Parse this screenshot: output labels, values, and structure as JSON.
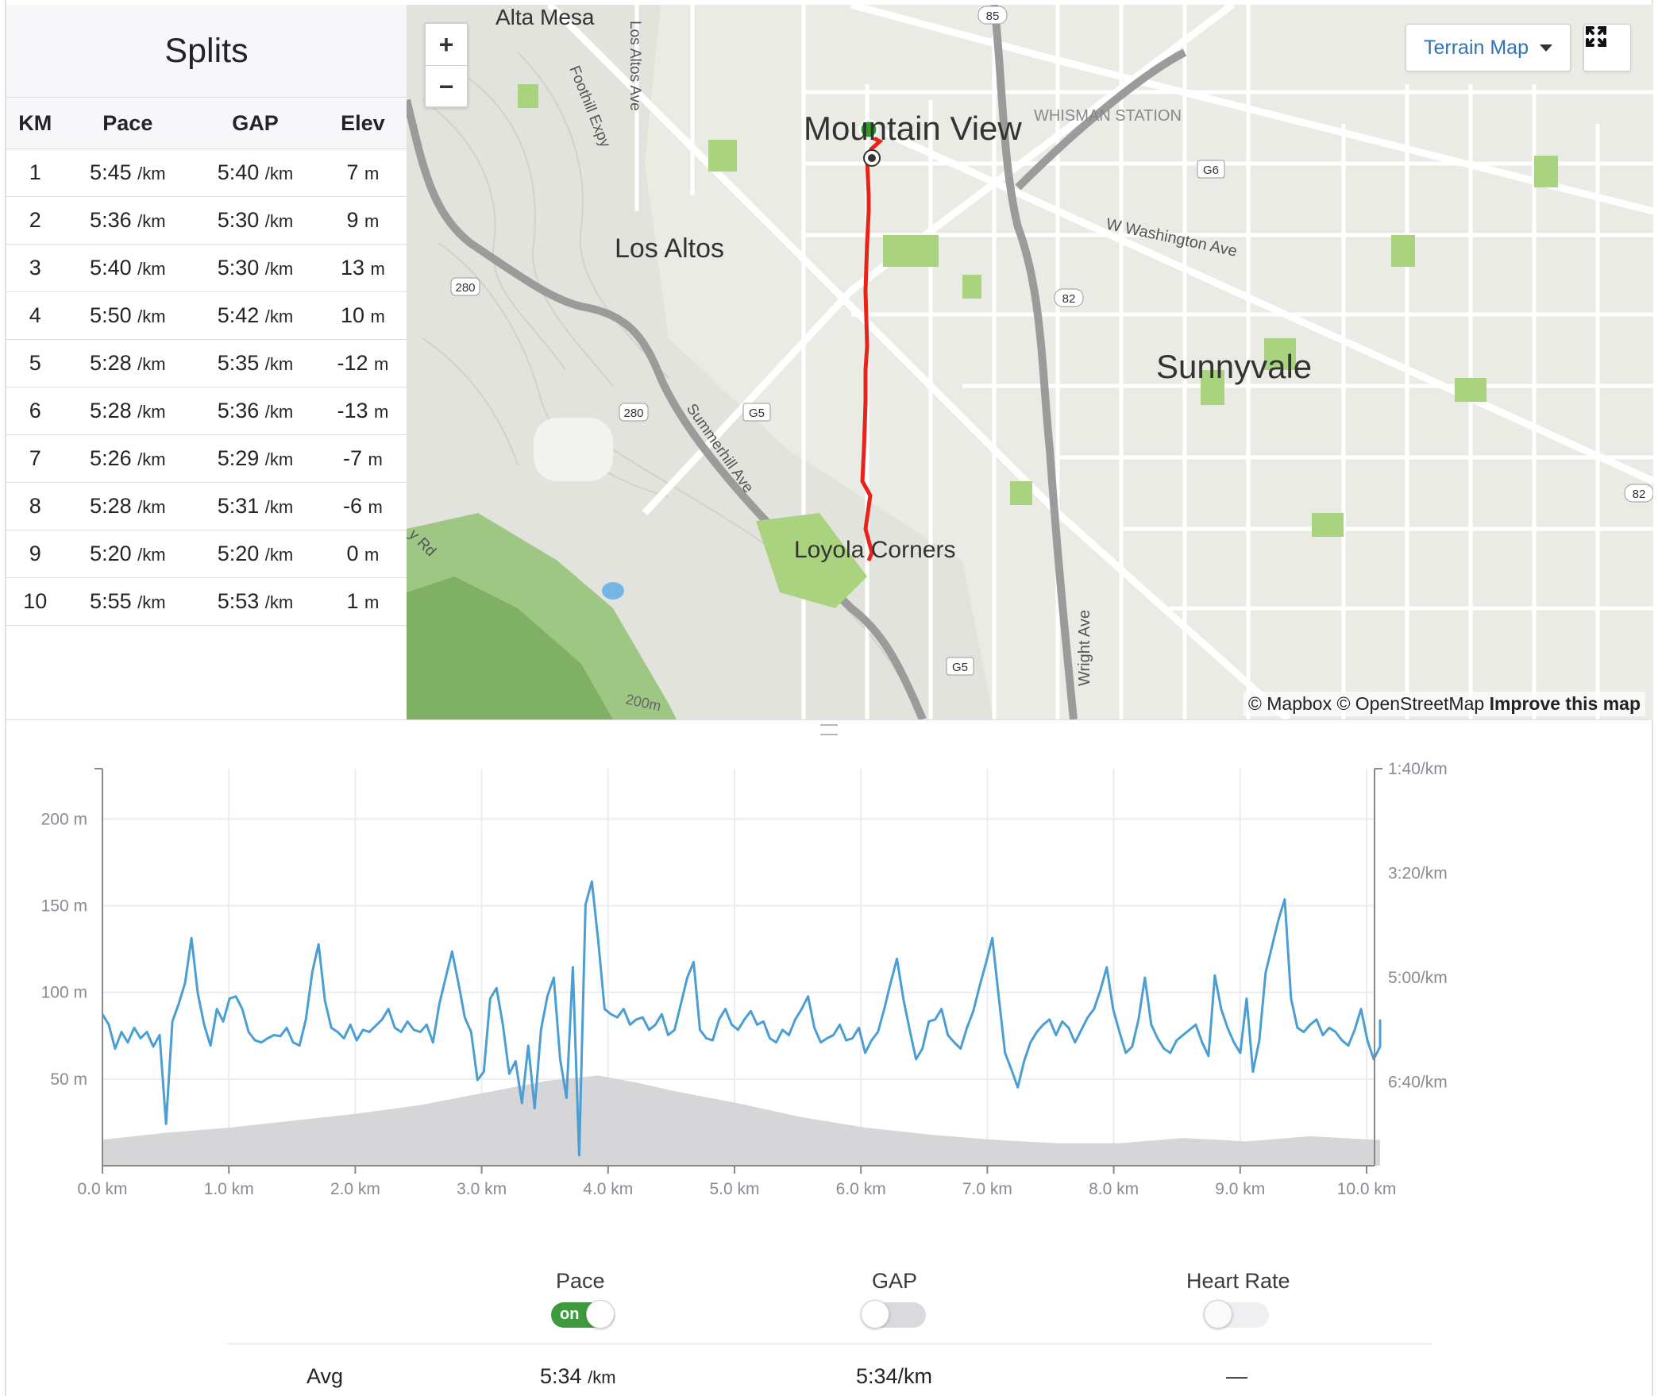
{
  "splits": {
    "title": "Splits",
    "columns": [
      "KM",
      "Pace",
      "GAP",
      "Elev"
    ],
    "rows": [
      {
        "km": "1",
        "pace": "5:45",
        "gap": "5:40",
        "elev": "7"
      },
      {
        "km": "2",
        "pace": "5:36",
        "gap": "5:30",
        "elev": "9"
      },
      {
        "km": "3",
        "pace": "5:40",
        "gap": "5:30",
        "elev": "13"
      },
      {
        "km": "4",
        "pace": "5:50",
        "gap": "5:42",
        "elev": "10"
      },
      {
        "km": "5",
        "pace": "5:28",
        "gap": "5:35",
        "elev": "-12"
      },
      {
        "km": "6",
        "pace": "5:28",
        "gap": "5:36",
        "elev": "-13"
      },
      {
        "km": "7",
        "pace": "5:26",
        "gap": "5:29",
        "elev": "-7"
      },
      {
        "km": "8",
        "pace": "5:28",
        "gap": "5:31",
        "elev": "-6"
      },
      {
        "km": "9",
        "pace": "5:20",
        "gap": "5:20",
        "elev": "0"
      },
      {
        "km": "10",
        "pace": "5:55",
        "gap": "5:53",
        "elev": "1"
      }
    ],
    "pace_unit": "/km",
    "elev_unit": "m"
  },
  "map": {
    "zoom_in": "+",
    "zoom_out": "−",
    "style_button": "Terrain Map",
    "fullscreen_icon": "expand-icon",
    "attribution_prefix": "© Mapbox © OpenStreetMap",
    "attribution_link": "Improve this map",
    "labels": {
      "alta_mesa": "Alta Mesa",
      "mountain_view": "Mountain View",
      "whisman_station": "WHISMAN STATION",
      "los_altos": "Los Altos",
      "sunnyvale": "Sunnyvale",
      "loyola_corners": "Loyola Corners",
      "foothill_expy": "Foothill Expy",
      "los_altos_ave": "Los Altos Ave",
      "summerhill_ave": "Summerhill Ave",
      "w_washington_ave": "W Washington Ave",
      "wright_ave": "Wright Ave",
      "rd_fragment": "y Rd",
      "contour_200": "200m"
    },
    "shields": {
      "s85": "85",
      "g6": "G6",
      "s82a": "82",
      "s280a": "280",
      "s280b": "280",
      "g5a": "G5",
      "g5b": "G5",
      "s82b": "82"
    },
    "colors": {
      "route": "#e8231a",
      "start": "#2aa02a",
      "park": "#a9d37e"
    }
  },
  "chart_data": {
    "type": "line",
    "xlabel": "",
    "ylabel": "",
    "x_ticks": [
      "0.0 km",
      "1.0 km",
      "2.0 km",
      "3.0 km",
      "4.0 km",
      "5.0 km",
      "6.0 km",
      "7.0 km",
      "8.0 km",
      "9.0 km",
      "10.0 km"
    ],
    "y_left_ticks": [
      "200 m",
      "150 m",
      "100 m",
      "50 m"
    ],
    "y_left_values": [
      200,
      150,
      100,
      50
    ],
    "y_right_ticks": [
      "1:40/km",
      "3:20/km",
      "5:00/km",
      "6:40/km"
    ],
    "xlim": [
      0,
      10.1
    ],
    "elevation_ylim": [
      0,
      240
    ],
    "pace_ylim_seconds": [
      100,
      480
    ],
    "series": [
      {
        "kind": "elevation-area",
        "color": "#d6d6d9",
        "x": [
          0,
          0.5,
          1.0,
          1.5,
          2.0,
          2.5,
          3.0,
          3.5,
          3.9,
          4.2,
          4.5,
          5.0,
          5.5,
          6.0,
          6.5,
          7.0,
          7.5,
          8.0,
          8.5,
          9.0,
          9.5,
          10.0,
          10.1
        ],
        "y": [
          15,
          19,
          22,
          26,
          30,
          35,
          42,
          49,
          52,
          48,
          43,
          36,
          28,
          22,
          18,
          15,
          13,
          13,
          16,
          14,
          17,
          15,
          15
        ]
      },
      {
        "kind": "pace-line",
        "color": "#4a9ed3",
        "x": [
          0,
          0.05,
          0.1,
          0.15,
          0.2,
          0.25,
          0.3,
          0.35,
          0.4,
          0.45,
          0.5,
          0.55,
          0.6,
          0.65,
          0.7,
          0.75,
          0.8,
          0.85,
          0.9,
          0.95,
          1.0,
          1.05,
          1.1,
          1.15,
          1.2,
          1.25,
          1.3,
          1.35,
          1.4,
          1.45,
          1.5,
          1.55,
          1.6,
          1.65,
          1.7,
          1.75,
          1.8,
          1.85,
          1.9,
          1.95,
          2.0,
          2.05,
          2.1,
          2.15,
          2.2,
          2.25,
          2.3,
          2.35,
          2.4,
          2.45,
          2.5,
          2.55,
          2.6,
          2.65,
          2.7,
          2.75,
          2.8,
          2.85,
          2.9,
          2.95,
          3.0,
          3.05,
          3.1,
          3.15,
          3.2,
          3.25,
          3.3,
          3.35,
          3.4,
          3.45,
          3.5,
          3.55,
          3.6,
          3.65,
          3.7,
          3.75,
          3.8,
          3.85,
          3.9,
          3.95,
          4.0,
          4.05,
          4.1,
          4.15,
          4.2,
          4.25,
          4.3,
          4.35,
          4.4,
          4.45,
          4.5,
          4.55,
          4.6,
          4.65,
          4.7,
          4.75,
          4.8,
          4.85,
          4.9,
          4.95,
          5.0,
          5.05,
          5.1,
          5.15,
          5.2,
          5.25,
          5.3,
          5.35,
          5.4,
          5.45,
          5.5,
          5.55,
          5.6,
          5.65,
          5.7,
          5.75,
          5.8,
          5.85,
          5.9,
          5.95,
          6.0,
          6.05,
          6.1,
          6.15,
          6.2,
          6.25,
          6.3,
          6.35,
          6.4,
          6.45,
          6.5,
          6.55,
          6.6,
          6.65,
          6.7,
          6.75,
          6.8,
          6.85,
          6.9,
          6.95,
          7.0,
          7.05,
          7.1,
          7.15,
          7.2,
          7.25,
          7.3,
          7.35,
          7.4,
          7.45,
          7.5,
          7.55,
          7.6,
          7.65,
          7.7,
          7.75,
          7.8,
          7.85,
          7.9,
          7.95,
          8.0,
          8.05,
          8.1,
          8.15,
          8.2,
          8.25,
          8.3,
          8.35,
          8.4,
          8.45,
          8.5,
          8.55,
          8.6,
          8.65,
          8.7,
          8.75,
          8.8,
          8.85,
          8.9,
          8.95,
          9.0,
          9.05,
          9.1,
          9.15,
          9.2,
          9.25,
          9.3,
          9.35,
          9.4,
          9.45,
          9.5,
          9.55,
          9.6,
          9.65,
          9.7,
          9.75,
          9.8,
          9.85,
          9.9,
          9.95,
          10.0,
          10.05,
          10.1
        ],
        "pace_seconds": [
          335,
          345,
          368,
          352,
          362,
          348,
          358,
          352,
          366,
          355,
          440,
          342,
          325,
          305,
          262,
          315,
          345,
          365,
          330,
          342,
          320,
          318,
          330,
          352,
          360,
          362,
          358,
          355,
          356,
          348,
          362,
          365,
          340,
          295,
          268,
          322,
          348,
          352,
          358,
          345,
          360,
          350,
          352,
          346,
          340,
          330,
          348,
          352,
          342,
          350,
          352,
          345,
          362,
          325,
          300,
          275,
          305,
          338,
          352,
          398,
          390,
          320,
          310,
          345,
          392,
          380,
          420,
          365,
          425,
          350,
          318,
          300,
          378,
          415,
          290,
          470,
          230,
          208,
          265,
          330,
          335,
          338,
          330,
          345,
          340,
          338,
          350,
          345,
          335,
          355,
          350,
          325,
          300,
          285,
          350,
          358,
          360,
          340,
          330,
          345,
          350,
          340,
          332,
          345,
          342,
          358,
          362,
          350,
          355,
          340,
          330,
          318,
          348,
          362,
          358,
          355,
          345,
          360,
          358,
          348,
          372,
          360,
          352,
          330,
          305,
          282,
          320,
          350,
          378,
          368,
          342,
          340,
          330,
          355,
          362,
          368,
          348,
          332,
          308,
          286,
          262,
          318,
          372,
          388,
          405,
          380,
          362,
          352,
          345,
          340,
          355,
          342,
          348,
          362,
          350,
          338,
          330,
          312,
          290,
          330,
          352,
          372,
          366,
          340,
          300,
          345,
          358,
          368,
          372,
          360,
          355,
          350,
          345,
          362,
          375,
          298,
          330,
          348,
          362,
          372,
          320,
          390,
          360,
          295,
          270,
          245,
          225,
          320,
          348,
          352,
          345,
          340,
          355,
          348,
          352,
          360,
          365,
          350,
          330,
          360,
          378,
          366,
          340,
          330,
          350,
          365,
          362,
          345,
          325,
          330,
          310
        ]
      }
    ]
  },
  "toggles": [
    {
      "label": "Pace",
      "state": "on",
      "on_text": "on",
      "color": "#3d9b3d"
    },
    {
      "label": "GAP",
      "state": "off"
    },
    {
      "label": "Heart Rate",
      "state": "off"
    }
  ],
  "stats": {
    "avg_label": "Avg",
    "pace_avg": "5:34",
    "pace_avg_unit": "/km",
    "gap_avg": "5:34/km",
    "hr_avg": "—"
  }
}
